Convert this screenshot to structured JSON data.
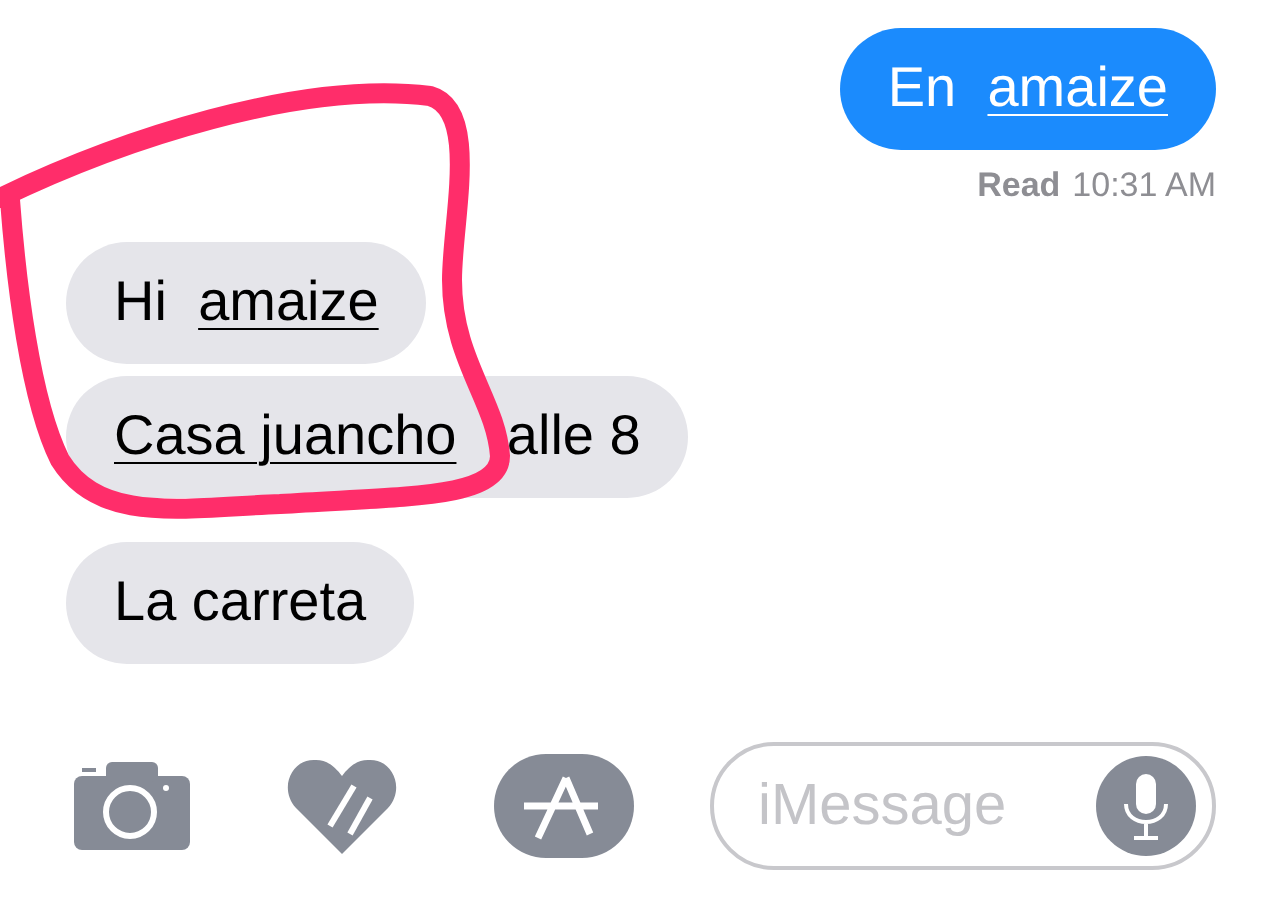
{
  "messages": [
    {
      "kind": "sent",
      "parts": [
        {
          "text": "En ",
          "link": false
        },
        {
          "text": "amaize",
          "link": true
        }
      ]
    },
    {
      "kind": "received",
      "parts": [
        {
          "text": "Hi ",
          "link": false
        },
        {
          "text": "amaize",
          "link": true
        }
      ]
    },
    {
      "kind": "received",
      "parts": [
        {
          "text": "Casa juancho",
          "link": true
        },
        {
          "text": "alle 8",
          "link": false
        }
      ]
    },
    {
      "kind": "received",
      "parts": [
        {
          "text": "La carreta",
          "link": false
        }
      ]
    }
  ],
  "receipt": {
    "label": "Read",
    "time": "10:31 AM"
  },
  "composer": {
    "placeholder": "iMessage"
  }
}
